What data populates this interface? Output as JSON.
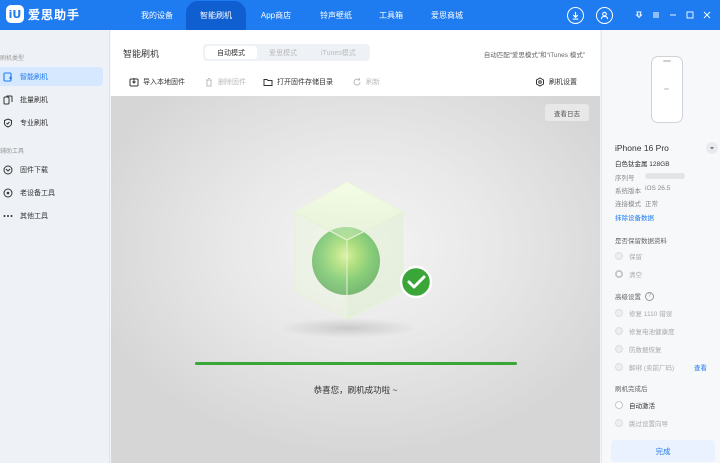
{
  "app": {
    "logo_mark": "iU",
    "title": "爱思助手"
  },
  "nav": {
    "items": [
      {
        "label": "我的设备",
        "active": false
      },
      {
        "label": "智能刷机",
        "active": true
      },
      {
        "label": "App商店",
        "active": false
      },
      {
        "label": "铃声壁纸",
        "active": false
      },
      {
        "label": "工具箱",
        "active": false
      },
      {
        "label": "爱思商城",
        "active": false
      }
    ],
    "icons": [
      "download-icon",
      "user-icon",
      "pin-icon",
      "menu-icon",
      "minimize-icon",
      "maximize-icon",
      "close-icon"
    ]
  },
  "sidebar": {
    "section_flash": "刷机类型",
    "section_tools": "辅助工具",
    "items": [
      {
        "label": "智能刷机",
        "icon": "smart-flash-icon",
        "active": true
      },
      {
        "label": "批量刷机",
        "icon": "batch-flash-icon",
        "active": false
      },
      {
        "label": "专业刷机",
        "icon": "pro-flash-icon",
        "active": false
      },
      {
        "label": "固件下载",
        "icon": "firmware-download-icon",
        "active": false
      },
      {
        "label": "老设备工具",
        "icon": "old-device-icon",
        "active": false
      },
      {
        "label": "其他工具",
        "icon": "more-icon",
        "active": false
      }
    ]
  },
  "main": {
    "title": "智能刷机",
    "tabs": [
      {
        "label": "自动模式",
        "active": true
      },
      {
        "label": "爱思模式",
        "active": false
      },
      {
        "label": "iTunes模式",
        "active": false
      }
    ],
    "auto_note": "自动匹配“爱思模式”和“iTunes 模式”",
    "toolbar": {
      "import": "导入本地固件",
      "delete": "删除固件",
      "open_dir": "打开固件存储目录",
      "refresh": "刷新",
      "settings": "刷机设置"
    },
    "view_log": "查看日志",
    "progress": 1.0,
    "success_message": "恭喜您，刷机成功啦 ~"
  },
  "device": {
    "name": "iPhone 16 Pro",
    "storage": "白色钛金属 128GB",
    "serial_label": "序列号",
    "version_label": "系统版本",
    "version": "iOS 26.5",
    "connection_label": "连接模式",
    "connection": "正常",
    "erase_link": "抹除设备数据"
  },
  "options": {
    "keep_data_title": "是否保留数据资料",
    "keep": "保留",
    "clear": "清空",
    "advanced_title": "高级设置",
    "fix1110": "修复 1110 错误",
    "fix_battery": "修复电池健康度",
    "anti_recovery": "防数据恢复",
    "unbind": "解绑 (卖前厂码)",
    "view": "查看",
    "after_title": "刷机完成后",
    "auto_activate": "自动激活",
    "skip_wizard": "跳过设置向导",
    "done": "完成"
  },
  "colors": {
    "brand": "#1e7bf0",
    "nav_active": "#0f5fd0",
    "success": "#3aa637"
  }
}
